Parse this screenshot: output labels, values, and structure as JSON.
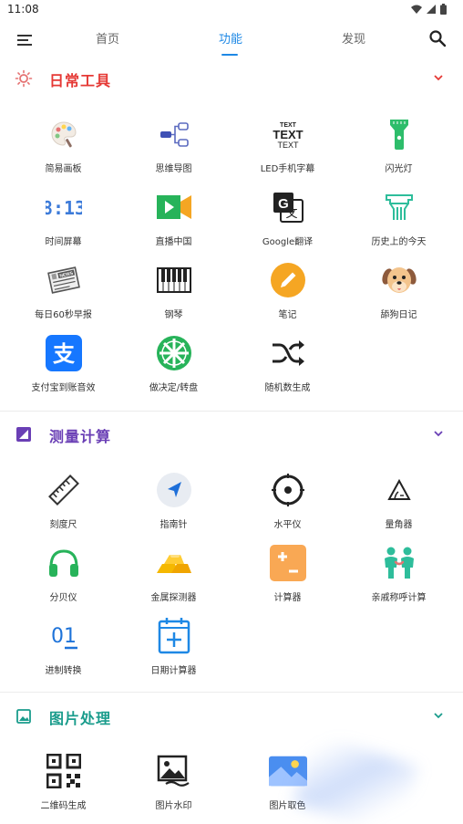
{
  "status": {
    "time": "11:08"
  },
  "tabs": [
    {
      "label": "首页"
    },
    {
      "label": "功能"
    },
    {
      "label": "发现"
    }
  ],
  "sections": [
    {
      "title": "日常工具",
      "color": "#e53935",
      "items": [
        {
          "label": "简易画板",
          "icon": "palette-icon"
        },
        {
          "label": "思维导图",
          "icon": "mind-map-icon"
        },
        {
          "label": "LED手机字幕",
          "icon": "led-text-icon"
        },
        {
          "label": "闪光灯",
          "icon": "flashlight-icon"
        },
        {
          "label": "时间屏幕",
          "icon": "clock-screen-icon"
        },
        {
          "label": "直播中国",
          "icon": "live-video-icon"
        },
        {
          "label": "Google翻译",
          "icon": "translate-icon"
        },
        {
          "label": "历史上的今天",
          "icon": "history-icon"
        },
        {
          "label": "每日60秒早报",
          "icon": "newspaper-icon"
        },
        {
          "label": "钢琴",
          "icon": "piano-icon"
        },
        {
          "label": "笔记",
          "icon": "note-pencil-icon"
        },
        {
          "label": "舔狗日记",
          "icon": "dog-icon"
        },
        {
          "label": "支付宝到账音效",
          "icon": "alipay-icon"
        },
        {
          "label": "做决定/转盘",
          "icon": "wheel-icon"
        },
        {
          "label": "随机数生成",
          "icon": "shuffle-icon"
        }
      ]
    },
    {
      "title": "测量计算",
      "color": "#6a3fb5",
      "items": [
        {
          "label": "刻度尺",
          "icon": "ruler-icon"
        },
        {
          "label": "指南针",
          "icon": "compass-icon"
        },
        {
          "label": "水平仪",
          "icon": "level-icon"
        },
        {
          "label": "量角器",
          "icon": "protractor-icon"
        },
        {
          "label": "分贝仪",
          "icon": "headphones-icon"
        },
        {
          "label": "金属探测器",
          "icon": "gold-bars-icon"
        },
        {
          "label": "计算器",
          "icon": "calculator-icon"
        },
        {
          "label": "亲戚称呼计算",
          "icon": "family-icon"
        },
        {
          "label": "进制转换",
          "icon": "binary-icon"
        },
        {
          "label": "日期计算器",
          "icon": "calendar-add-icon"
        }
      ]
    },
    {
      "title": "图片处理",
      "color": "#1a9c8c",
      "items": [
        {
          "label": "二维码生成",
          "icon": "qr-code-icon"
        },
        {
          "label": "图片水印",
          "icon": "image-watermark-icon"
        },
        {
          "label": "图片取色",
          "icon": "image-color-icon"
        }
      ]
    }
  ]
}
